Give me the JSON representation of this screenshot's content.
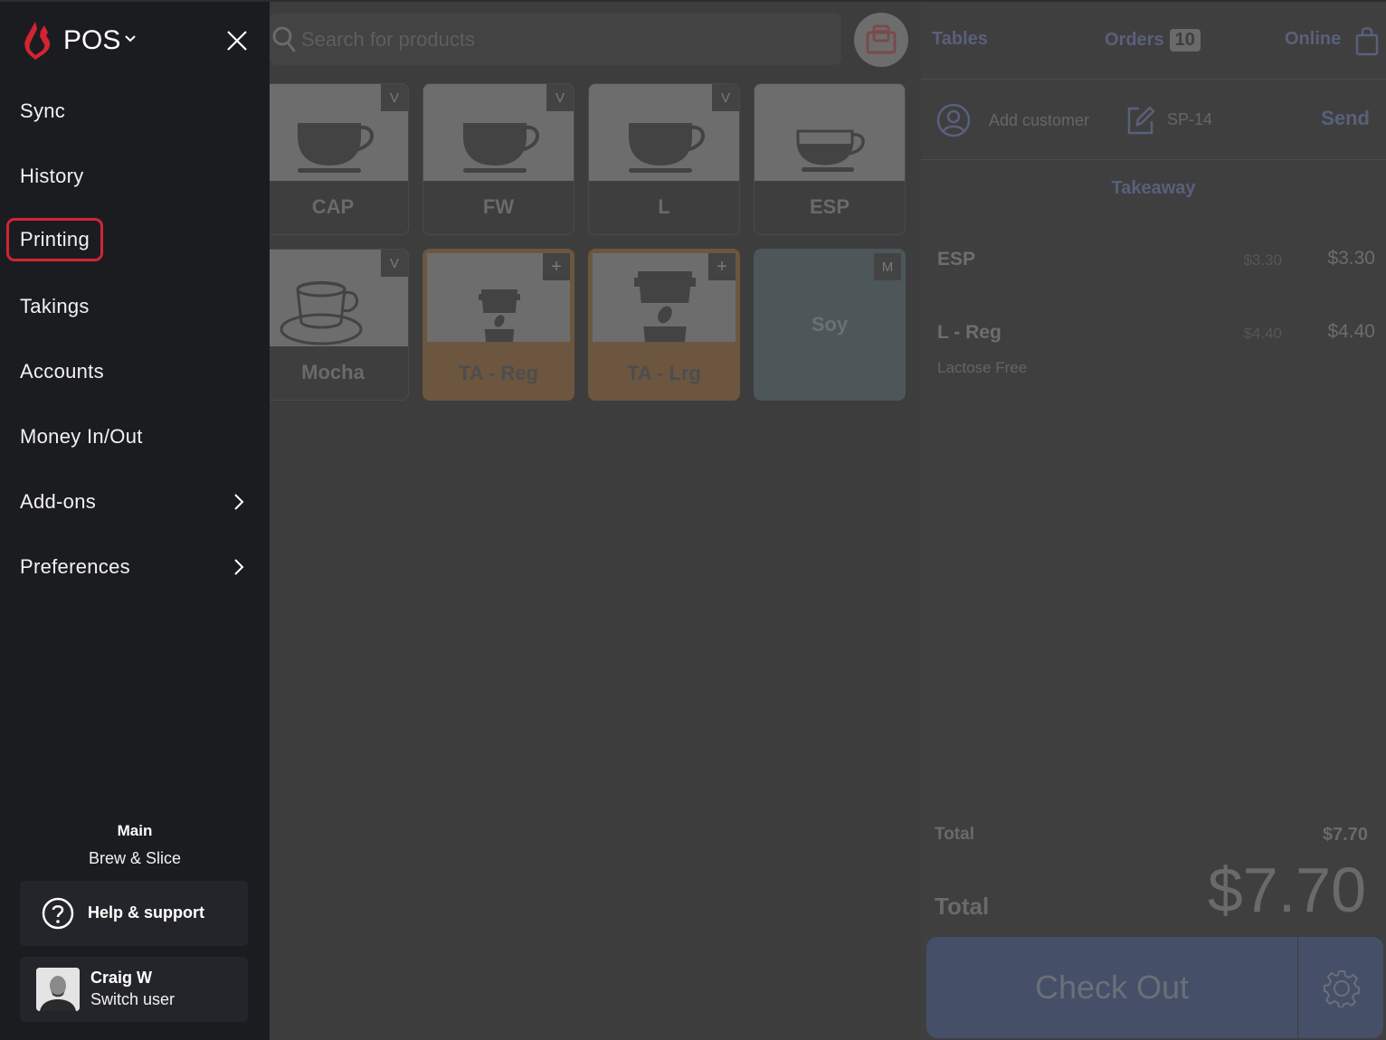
{
  "sidebar": {
    "app_name": "POS",
    "menu_items": [
      {
        "label": "Sync",
        "submenu": false,
        "selected": false
      },
      {
        "label": "History",
        "submenu": false,
        "selected": false
      },
      {
        "label": "Printing",
        "submenu": false,
        "selected": true
      },
      {
        "label": "Takings",
        "submenu": false,
        "selected": false
      },
      {
        "label": "Accounts",
        "submenu": false,
        "selected": false
      },
      {
        "label": "Money In/Out",
        "submenu": false,
        "selected": false
      },
      {
        "label": "Add-ons",
        "submenu": true,
        "selected": false
      },
      {
        "label": "Preferences",
        "submenu": true,
        "selected": false
      }
    ],
    "register": "Main",
    "store_name": "Brew & Slice",
    "help_label": "Help & support",
    "user_name": "Craig W",
    "switch_user_label": "Switch user"
  },
  "search": {
    "placeholder": "Search for products"
  },
  "products": [
    {
      "label": "CAP",
      "badge": "V",
      "icon": "cup-icon"
    },
    {
      "label": "FW",
      "badge": "V",
      "icon": "cup-icon"
    },
    {
      "label": "L",
      "badge": "V",
      "icon": "cup-icon"
    },
    {
      "label": "ESP",
      "badge": "",
      "icon": "espresso-cup-icon"
    },
    {
      "label": "Mocha",
      "badge": "V",
      "icon": "mug-saucer-icon"
    },
    {
      "label": "TA - Reg",
      "badge": "+",
      "icon": "takeaway-cup-icon"
    },
    {
      "label": "TA - Lrg",
      "badge": "+",
      "icon": "takeaway-cup-icon"
    },
    {
      "label": "Soy",
      "badge": "M",
      "icon": ""
    }
  ],
  "order": {
    "tabs": {
      "tables": "Tables",
      "orders": "Orders",
      "orders_count": "10",
      "online": "Online"
    },
    "add_customer": "Add customer",
    "order_ref": "SP-14",
    "send": "Send",
    "type": "Takeaway",
    "lines": [
      {
        "name": "ESP",
        "unit_price": "$3.30",
        "total": "$3.30",
        "modifier": ""
      },
      {
        "name": "L - Reg",
        "unit_price": "$4.40",
        "total": "$4.40",
        "modifier": "Lactose Free"
      }
    ],
    "total_label": "Total",
    "total_small": "$7.70",
    "total_big": "$7.70",
    "checkout": "Check Out"
  },
  "colors": {
    "brand_red": "#d32433",
    "sidebar_bg": "#1b1c20",
    "checkout_bg": "#454f68"
  }
}
